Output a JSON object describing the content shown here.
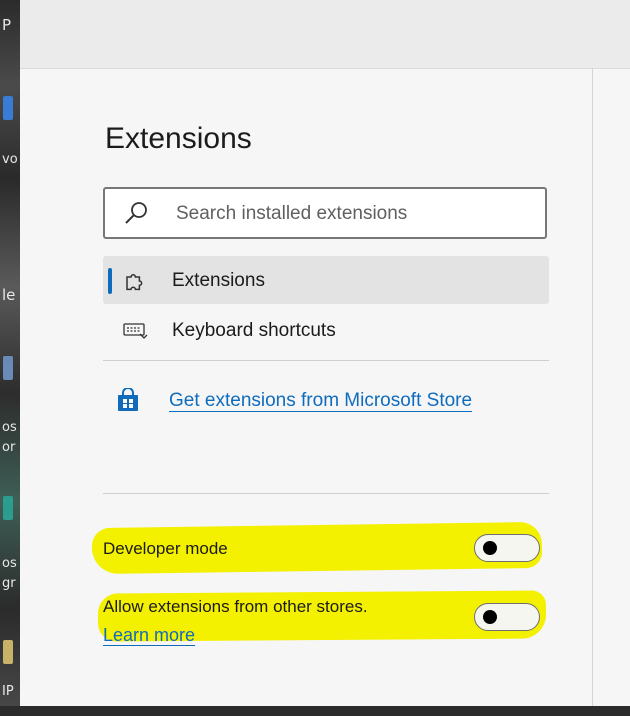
{
  "page": {
    "title": "Extensions",
    "search": {
      "placeholder": "Search installed extensions"
    },
    "nav": [
      {
        "label": "Extensions",
        "selected": true,
        "icon": "puzzle-icon"
      },
      {
        "label": "Keyboard shortcuts",
        "selected": false,
        "icon": "keyboard-icon"
      }
    ],
    "store_link": {
      "label": "Get extensions from Microsoft Store",
      "icon": "store-bag-icon"
    },
    "settings": {
      "developer_mode": {
        "label": "Developer mode",
        "enabled": false
      },
      "other_stores": {
        "label": "Allow extensions from other stores.",
        "link": "Learn more",
        "enabled": false
      }
    }
  },
  "colors": {
    "accent": "#0f6cbd",
    "highlight": "#f3f000",
    "background": "#f6f6f6",
    "selected_item": "#e3e3e3"
  }
}
